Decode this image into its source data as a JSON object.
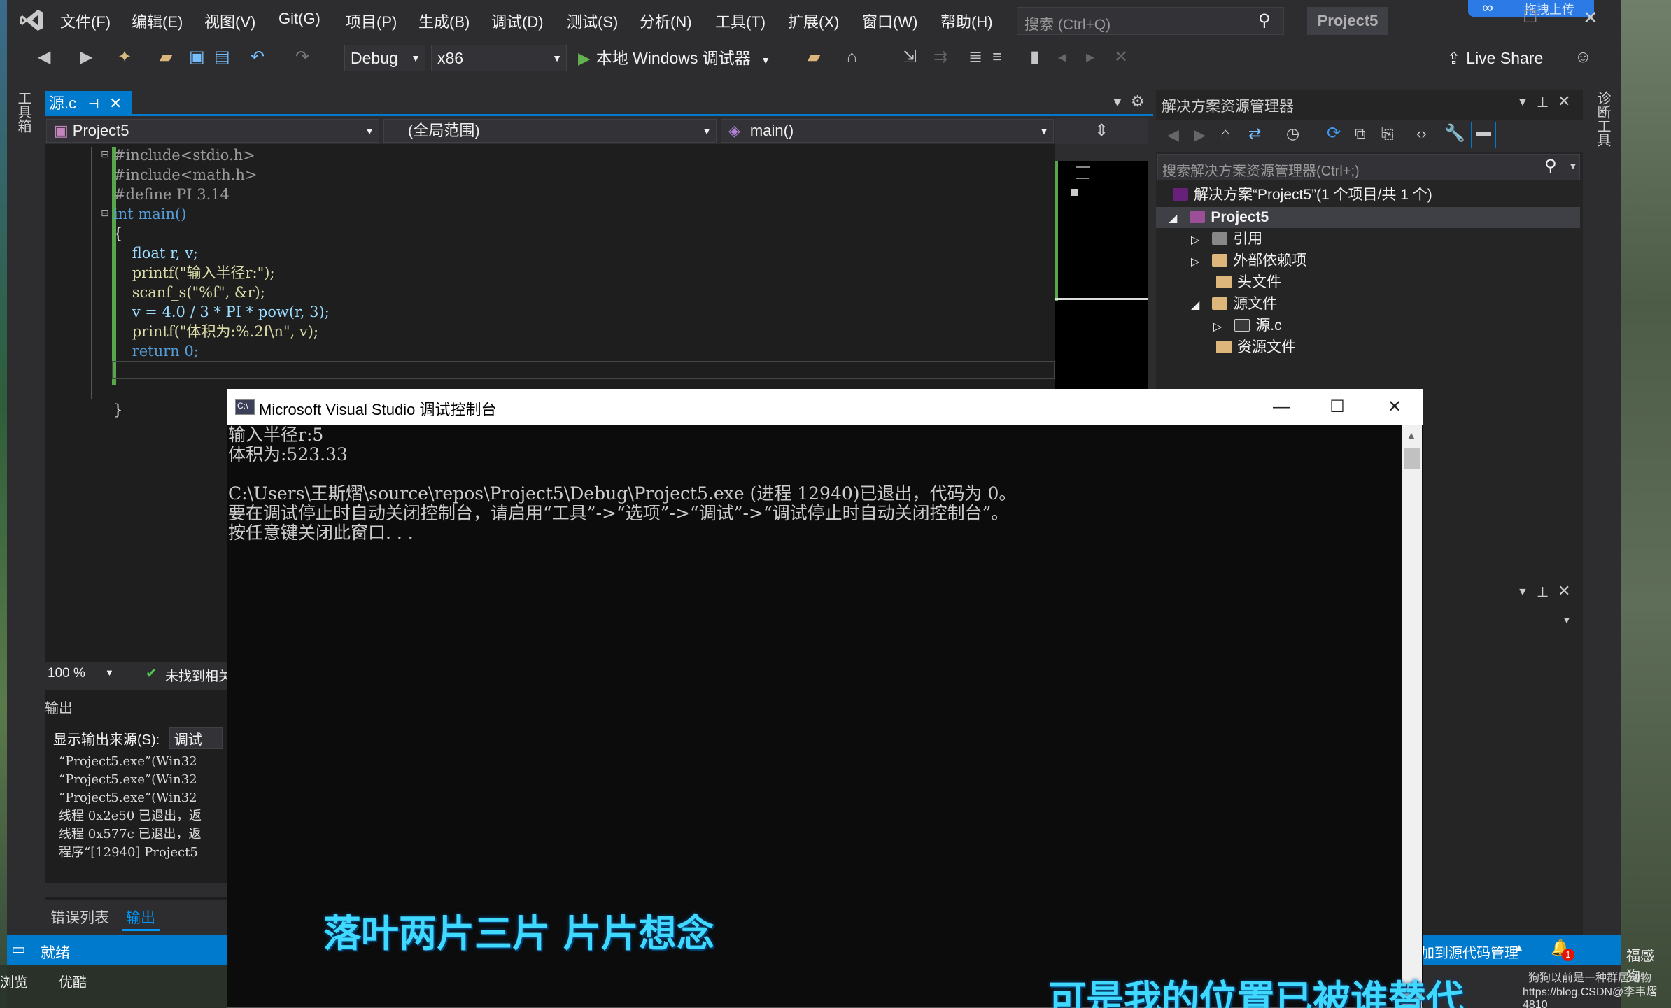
{
  "menu": [
    "文件(F)",
    "编辑(E)",
    "视图(V)",
    "Git(G)",
    "项目(P)",
    "生成(B)",
    "调试(D)",
    "测试(S)",
    "分析(N)",
    "工具(T)",
    "扩展(X)",
    "窗口(W)",
    "帮助(H)"
  ],
  "search": {
    "placeholder": "搜索 (Ctrl+Q)"
  },
  "project_title": "Project5",
  "cloud_upload": "拖拽上传",
  "toolbar": {
    "config": "Debug",
    "platform": "x86",
    "run_label": "本地 Windows 调试器",
    "live_share": "Live Share"
  },
  "toolstrip_label": "工具箱",
  "editor": {
    "tab_label": "源.c",
    "nav_project": "Project5",
    "nav_scope": "(全局范围)",
    "nav_member": "main()",
    "zoom": "100 %",
    "status": "未找到相关",
    "code": [
      "#include<stdio.h>",
      "#include<math.h>",
      "#define PI 3.14",
      "int main()",
      "{",
      "    float r, v;",
      "    printf(\"输入半径r:\");",
      "    scanf_s(\"%f\", &r);",
      "    v = 4.0 / 3 * PI * pow(r, 3);",
      "    printf(\"体积为:%.2f\\n\", v);",
      "    return 0;",
      "",
      "}"
    ]
  },
  "output": {
    "title": "输出",
    "source_label": "显示输出来源(S):",
    "source_value": "调试",
    "lines": [
      "“Project5.exe”(Win32",
      "“Project5.exe”(Win32",
      "“Project5.exe”(Win32",
      "线程 0x2e50 已退出，返",
      "线程 0x577c 已退出，返",
      "程序“[12940] Project5"
    ],
    "tab_errors": "错误列表",
    "tab_output": "输出"
  },
  "statusbar": {
    "ready": "就绪",
    "source_control": "添加到源代码管理",
    "notif_count": "1"
  },
  "taskbar": {
    "item1": "浏览",
    "item2": "优酷"
  },
  "solution": {
    "title": "解决方案资源管理器",
    "search_placeholder": "搜索解决方案资源管理器(Ctrl+;)",
    "items": [
      {
        "label": "解决方案“Project5”(1 个项目/共 1 个)"
      },
      {
        "label": "Project5"
      },
      {
        "label": "引用"
      },
      {
        "label": "外部依赖项"
      },
      {
        "label": "头文件"
      },
      {
        "label": "源文件"
      },
      {
        "label": "源.c"
      },
      {
        "label": "资源文件"
      }
    ]
  },
  "diag_label": "诊断工具",
  "console": {
    "title": "Microsoft Visual Studio 调试控制台",
    "icon_text": "C:\\",
    "lines": [
      "输入半径r:5",
      "体积为:523.33",
      "",
      "C:\\Users\\王斯熠\\source\\repos\\Project5\\Debug\\Project5.exe (进程 12940)已退出，代码为 0。",
      "要在调试停止时自动关闭控制台，请启用“工具”->“选项”->“调试”->“调试停止时自动关闭控制台”。",
      "按任意键关闭此窗口. . ."
    ]
  },
  "subtitles": {
    "line1": "落叶两片三片 片片想念",
    "line2": "可是我的位置已被谁替代"
  },
  "watermark": "https://blog.CSDN@李韦熠4810",
  "desktop_right": {
    "text1": "福感 狗",
    "text2": "狗狗以前是一种群居动物"
  }
}
